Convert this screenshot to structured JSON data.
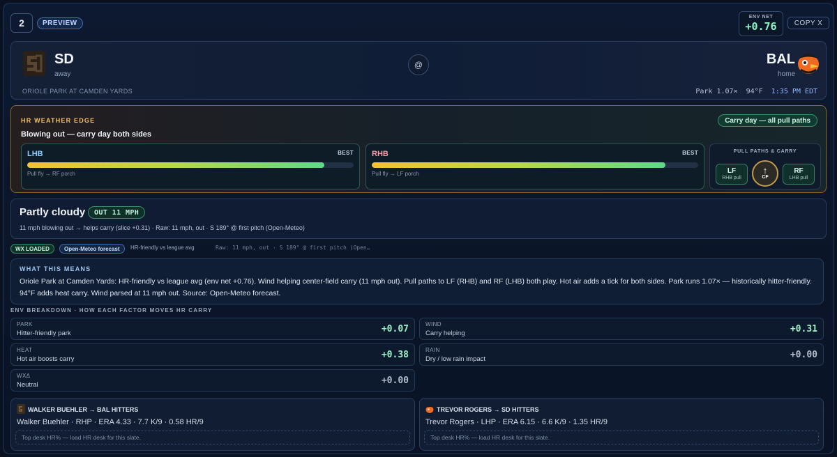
{
  "header": {
    "slot_number": "2",
    "badge": "PREVIEW",
    "env_net_label": "ENV NET",
    "env_net_value": "+0.76",
    "copy_label": "COPY X"
  },
  "matchup": {
    "away": {
      "abbr": "SD",
      "role": "away"
    },
    "home": {
      "abbr": "BAL",
      "role": "home"
    },
    "separator": "@",
    "venue": "ORIOLE PARK AT CAMDEN YARDS",
    "park": "Park 1.07×",
    "temp": "94°F",
    "time": "1:35 PM EDT"
  },
  "edge": {
    "title": "HR WEATHER EDGE",
    "headline": "Blowing out — carry day both sides",
    "pill": "Carry day — all pull paths",
    "sides": [
      {
        "name": "LHB",
        "tag": "BEST",
        "level": 0.91,
        "note": "Pull fly → RF porch",
        "color": "#8ecbff"
      },
      {
        "name": "RHB",
        "tag": "BEST",
        "level": 0.9,
        "note": "Pull fly → LF porch",
        "color": "#ff9aa8"
      }
    ],
    "pull_paths": {
      "title": "PULL PATHS & CARRY",
      "left": {
        "code": "LF",
        "sub": "RHB pull"
      },
      "center": {
        "code": "CF",
        "arrow": "↑"
      },
      "right": {
        "code": "RF",
        "sub": "LHB pull"
      }
    }
  },
  "weather": {
    "condition": "Partly cloudy",
    "wind_badge": "OUT 11 MPH",
    "description": "11 mph blowing out → helps carry (slice +0.31) · Raw: 11 mph, out · S 189° @ first pitch (Open-Meteo)"
  },
  "chips": {
    "loaded": "WX LOADED",
    "source": "Open-Meteo forecast",
    "summary": "HR-friendly vs league avg",
    "raw": "Raw: 11 mph, out · S 189° @ first pitch (Open…"
  },
  "means": {
    "title": "WHAT THIS MEANS",
    "body": "Oriole Park at Camden Yards: HR-friendly vs league avg (env net +0.76). Wind helping center-field carry (11 mph out). Pull paths to LF (RHB) and RF (LHB) both play. Hot air adds a tick for both sides. Park runs 1.07× — historically hitter-friendly. 94°F adds heat carry. Wind parsed at 11 mph out. Source: Open-Meteo forecast."
  },
  "breakdown": {
    "title": "ENV BREAKDOWN · HOW EACH FACTOR MOVES HR CARRY",
    "factors": [
      {
        "key": "PARK",
        "desc": "Hitter-friendly park",
        "value": "+0.07"
      },
      {
        "key": "WIND",
        "desc": "Carry helping",
        "value": "+0.31"
      },
      {
        "key": "HEAT",
        "desc": "Hot air boosts carry",
        "value": "+0.38"
      },
      {
        "key": "RAIN",
        "desc": "Dry / low rain impact",
        "value": "+0.00"
      },
      {
        "key": "WXΔ",
        "desc": "Neutral",
        "value": "+0.00"
      }
    ]
  },
  "pitchers": [
    {
      "title": "WALKER BUEHLER → BAL HITTERS",
      "stats": "Walker Buehler · RHP · ERA 4.33 · 7.7 K/9 · 0.58 HR/9",
      "desk": "Top desk HR% — load HR desk for this slate."
    },
    {
      "title": "TREVOR ROGERS → SD HITTERS",
      "stats": "Trevor Rogers · LHP · ERA 6.15 · 6.6 K/9 · 1.35 HR/9",
      "desk": "Top desk HR% — load HR desk for this slate."
    }
  ]
}
